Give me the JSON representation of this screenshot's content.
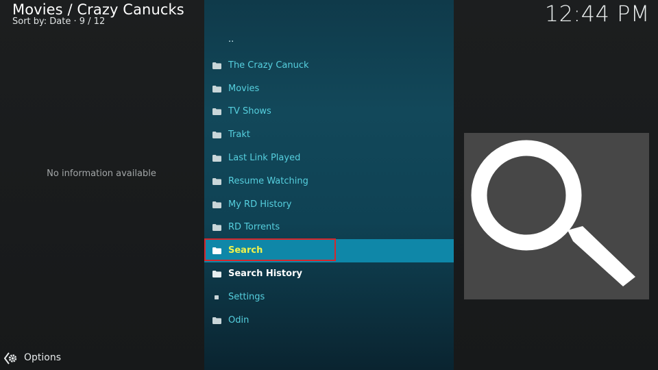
{
  "header": {
    "title": "Movies / Crazy Canucks",
    "sort_info": "Sort by: Date  ·  9 / 12"
  },
  "clock": "12:44 PM",
  "info_panel": {
    "message": "No information available"
  },
  "list": {
    "items": [
      {
        "label": "..",
        "icon": "none"
      },
      {
        "label": "The Crazy Canuck",
        "icon": "folder-icon"
      },
      {
        "label": "Movies",
        "icon": "folder-icon"
      },
      {
        "label": "TV Shows",
        "icon": "folder-icon"
      },
      {
        "label": "Trakt",
        "icon": "folder-icon"
      },
      {
        "label": "Last Link Played",
        "icon": "folder-icon"
      },
      {
        "label": "Resume Watching",
        "icon": "folder-icon"
      },
      {
        "label": "My RD History",
        "icon": "folder-icon"
      },
      {
        "label": "RD Torrents",
        "icon": "folder-icon"
      },
      {
        "label": "Search",
        "icon": "folder-icon",
        "selected": true
      },
      {
        "label": "Search History",
        "icon": "folder-icon"
      },
      {
        "label": "Settings",
        "icon": "file-icon"
      },
      {
        "label": "Odin",
        "icon": "folder-icon"
      }
    ]
  },
  "thumbnail": {
    "icon": "magnifier-icon"
  },
  "footer": {
    "options_label": "Options",
    "options_icon": "gear-icon"
  },
  "colors": {
    "accent": "#0f87a8",
    "item_text": "#56d0df",
    "selected_text": "#f2f34b",
    "focus_border": "#d8262b"
  }
}
